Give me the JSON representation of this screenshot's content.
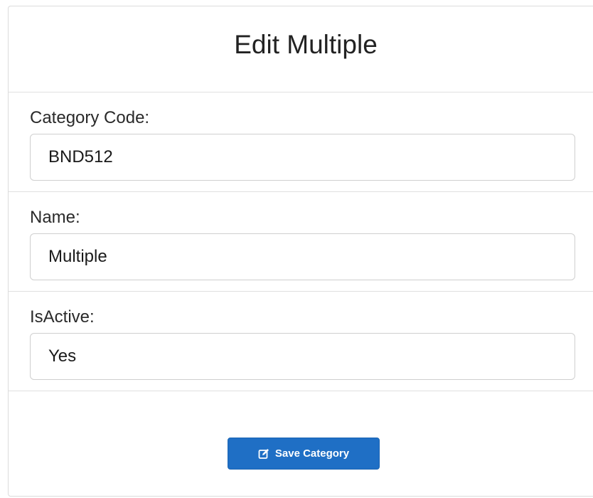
{
  "header": {
    "title": "Edit Multiple"
  },
  "fields": [
    {
      "label": "Category Code:",
      "value": "BND512"
    },
    {
      "label": "Name:",
      "value": "Multiple"
    },
    {
      "label": "IsActive:",
      "value": "Yes"
    }
  ],
  "actions": {
    "save_label": "Save Category",
    "save_icon": "edit-icon",
    "accent_color": "#1f6fc5"
  }
}
